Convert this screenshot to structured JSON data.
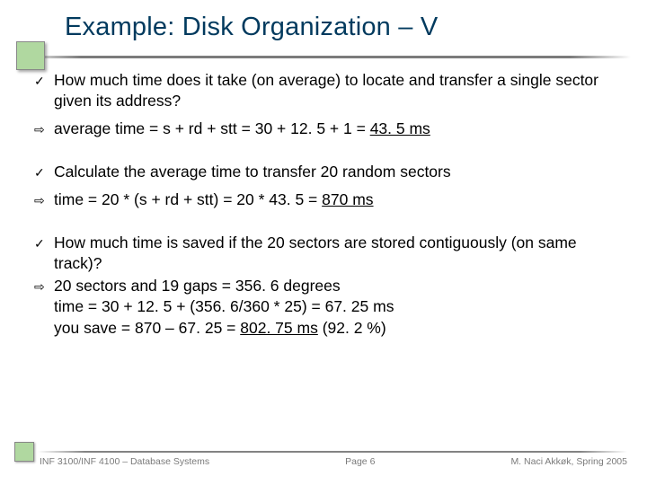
{
  "title": "Example: Disk Organization – V",
  "items": [
    {
      "bullet": "check",
      "text": "How much time does it take (on average) to locate and transfer a single sector given its address?"
    },
    {
      "bullet": "arrow",
      "tokens": [
        "average time = s + rd + stt = 30 + 12. 5 + 1 = ",
        {
          "u": "43. 5 ms"
        }
      ]
    },
    {
      "bullet": "check",
      "text": "Calculate the average time to transfer 20 random sectors"
    },
    {
      "bullet": "arrow",
      "tokens": [
        "time = 20 * (s + rd + stt) = 20 * 43. 5 = ",
        {
          "u": "870 ms"
        }
      ]
    },
    {
      "bullet": "check",
      "text": "How much time is saved if the 20 sectors are stored contiguously (on same track)?"
    },
    {
      "bullet": "arrow",
      "tokens": [
        "20 sectors and 19 gaps = 356. 6 degrees",
        {
          "br": 1
        },
        "time = 30 + 12. 5 + (356. 6/360 * 25) = 67. 25 ms",
        {
          "br": 1
        },
        "you save = 870 – 67. 25 = ",
        {
          "u": "802. 75 ms"
        },
        "   (92. 2 %)"
      ]
    }
  ],
  "footer": {
    "left": "INF 3100/INF 4100 – Database Systems",
    "center": "Page 6",
    "right": "M. Naci Akkøk, Spring 2005"
  },
  "bullet_glyphs": {
    "check": "✓",
    "arrow": "⇨"
  }
}
